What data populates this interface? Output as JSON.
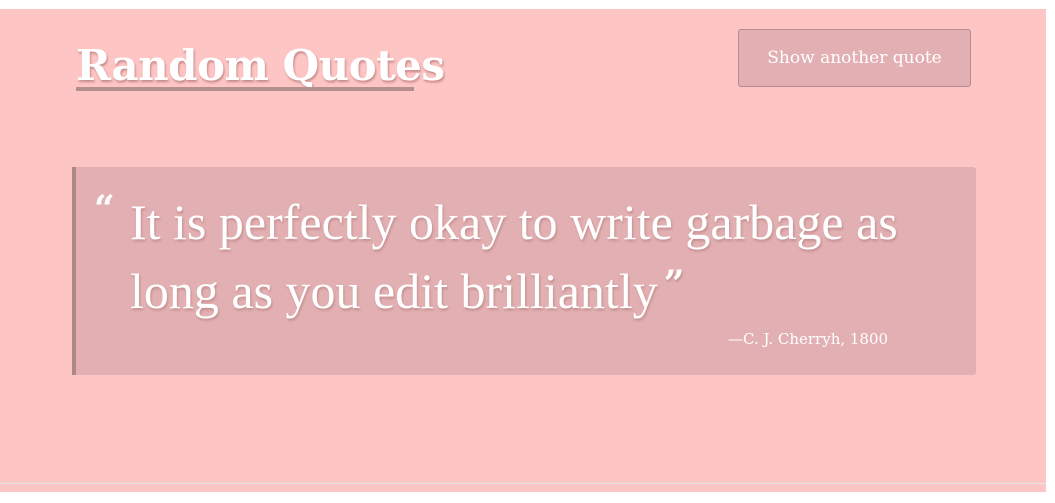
{
  "header": {
    "title": "Random Quotes",
    "button_label": "Show another quote"
  },
  "quote": {
    "open_mark": "“",
    "text": "It is perfectly okay to write garbage as long as you edit brilliantly",
    "close_mark": "”",
    "attribution": "—C. J. Cherryh, 1800"
  },
  "colors": {
    "background": "#fec5c5",
    "button": "#e2b0b2",
    "quote_box": "#e2b0b2",
    "quote_border": "#ae8787",
    "text": "#ffffff"
  }
}
